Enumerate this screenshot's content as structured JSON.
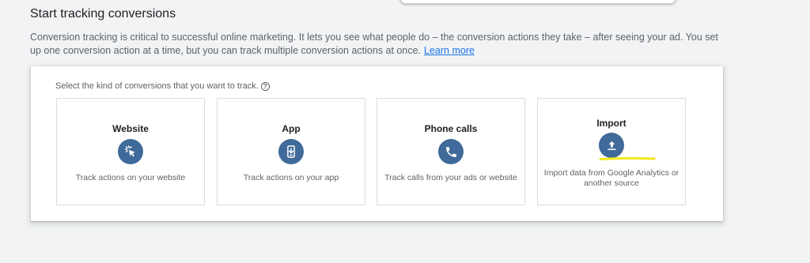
{
  "header": {
    "title": "Start tracking conversions"
  },
  "intro": {
    "text": "Conversion tracking is critical to successful online marketing. It lets you see what people do – the conversion actions they take – after seeing your ad. You set up one conversion action at a time, but you can track multiple conversion actions at once.",
    "link_label": "Learn more"
  },
  "panel": {
    "prompt": "Select the kind of conversions that you want to track.",
    "help_glyph": "?",
    "cards": [
      {
        "title": "Website",
        "icon": "cursor-click-icon",
        "description": "Track actions on your website"
      },
      {
        "title": "App",
        "icon": "smartphone-download-icon",
        "description": "Track actions on your app"
      },
      {
        "title": "Phone calls",
        "icon": "phone-icon",
        "description": "Track calls from your ads or website"
      },
      {
        "title": "Import",
        "icon": "upload-icon",
        "description": "Import data from Google Analytics or another source"
      }
    ]
  },
  "colors": {
    "accent_icon_bg": "#3f6a99",
    "link": "#1a73e8",
    "highlight": "#f4e81c"
  }
}
